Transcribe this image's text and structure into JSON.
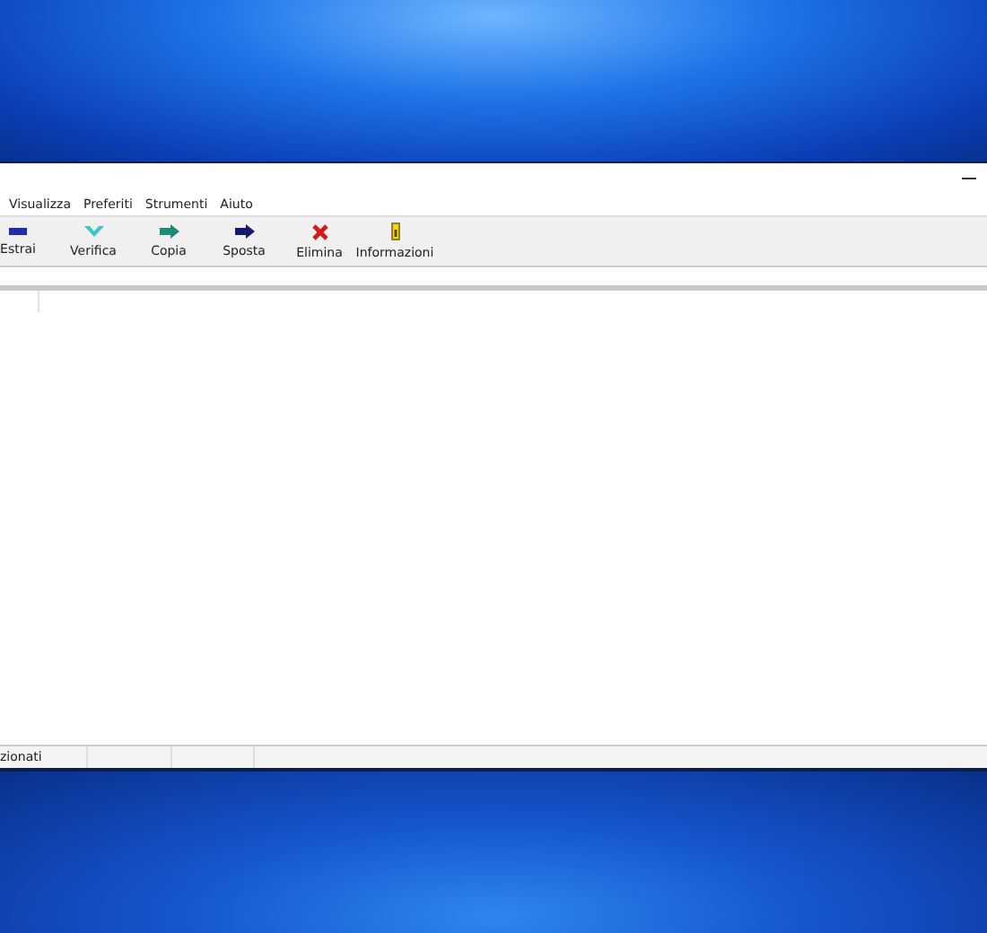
{
  "menu": [
    "Visualizza",
    "Preferiti",
    "Strumenti",
    "Aiuto"
  ],
  "toolbar": [
    {
      "kind": "extract",
      "label": "Estrai"
    },
    {
      "kind": "test",
      "label": "Verifica"
    },
    {
      "kind": "copy",
      "label": "Copia"
    },
    {
      "kind": "move",
      "label": "Sposta"
    },
    {
      "kind": "delete",
      "label": "Elimina"
    },
    {
      "kind": "info",
      "label": "Informazioni"
    }
  ],
  "status_bar": [
    "zionati"
  ]
}
